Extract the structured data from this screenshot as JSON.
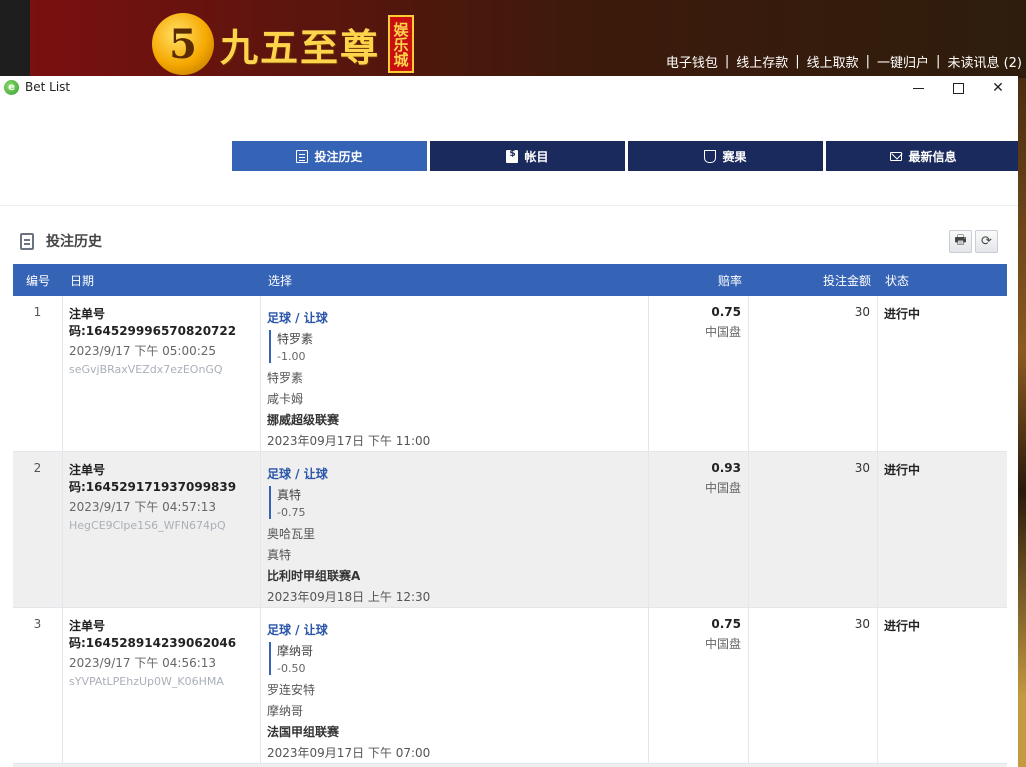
{
  "site": {
    "logo_digit": "5",
    "logo_text": "九五至尊",
    "logo_badge": "娱乐城",
    "links": [
      "电子钱包",
      "线上存款",
      "线上取款",
      "一键归户",
      "未读讯息 (2)"
    ],
    "separator": "|"
  },
  "window": {
    "icon": "e",
    "title": "Bet List",
    "controls": [
      "minimize-icon",
      "maximize-icon",
      "close-icon"
    ],
    "close_glyph": "✕"
  },
  "tabs": [
    {
      "label": "投注历史",
      "icon": "clipboard-icon",
      "active": true
    },
    {
      "label": "帐目",
      "icon": "bill-icon",
      "active": false
    },
    {
      "label": "赛果",
      "icon": "trophy-icon",
      "active": false
    },
    {
      "label": "最新信息",
      "icon": "mail-icon",
      "active": false
    }
  ],
  "section": {
    "title": "投注历史",
    "print_glyph": "🖶",
    "refresh_glyph": "⟳"
  },
  "table": {
    "headers": [
      "编号",
      "日期",
      "选择",
      "赔率",
      "投注金额",
      "状态"
    ],
    "rows": [
      {
        "index": "1",
        "ticket": "注单号码:164529996570820722",
        "datetime": "2023/9/17 下午 05:00:25",
        "hash": "seGvjBRaxVEZdx7ezEOnGQ",
        "sel_type": "足球 / 让球",
        "pick_team": "特罗素",
        "pick_hcp": "-1.00",
        "home": "特罗素",
        "away": "咸卡姆",
        "league": "挪威超级联赛",
        "match_time": "2023年09月17日 下午 11:00",
        "odds": "0.75",
        "market": "中国盘",
        "stake": "30",
        "status": "进行中"
      },
      {
        "index": "2",
        "ticket": "注单号码:164529171937099839",
        "datetime": "2023/9/17 下午 04:57:13",
        "hash": "HegCE9Clpe1S6_WFN674pQ",
        "sel_type": "足球 / 让球",
        "pick_team": "真特",
        "pick_hcp": "-0.75",
        "home": "奥哈瓦里",
        "away": "真特",
        "league": "比利时甲组联赛A",
        "match_time": "2023年09月18日 上午 12:30",
        "odds": "0.93",
        "market": "中国盘",
        "stake": "30",
        "status": "进行中"
      },
      {
        "index": "3",
        "ticket": "注单号码:164528914239062046",
        "datetime": "2023/9/17 下午 04:56:13",
        "hash": "sYVPAtLPEhzUp0W_K06HMA",
        "sel_type": "足球 / 让球",
        "pick_team": "摩纳哥",
        "pick_hcp": "-0.50",
        "home": "罗连安特",
        "away": "摩纳哥",
        "league": "法国甲组联赛",
        "match_time": "2023年09月17日 下午 07:00",
        "odds": "0.75",
        "market": "中国盘",
        "stake": "30",
        "status": "进行中"
      }
    ]
  },
  "colors": {
    "tab_dark": "#1b2a5c",
    "tab_active": "#3563b5",
    "header_blue": "#3563b5",
    "link_blue": "#2a55a8"
  }
}
